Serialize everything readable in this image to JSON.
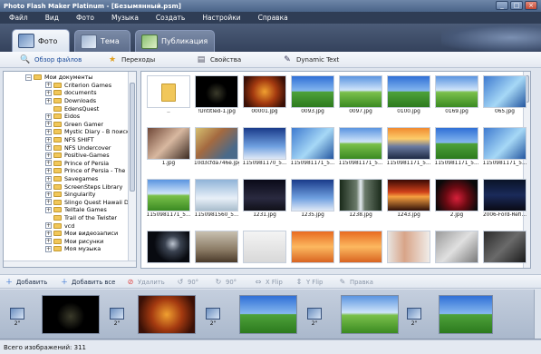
{
  "window": {
    "title": "Photo Flash Maker Platinum - [Безымянный.psm]"
  },
  "menu": [
    "Файл",
    "Вид",
    "Фото",
    "Музыка",
    "Создать",
    "Настройки",
    "Справка"
  ],
  "main_tabs": [
    {
      "label": "Фото",
      "active": true
    },
    {
      "label": "Тема",
      "active": false
    },
    {
      "label": "Публикация",
      "active": false
    }
  ],
  "sub_tabs": [
    {
      "label": "Обзор файлов",
      "icon": "magnifier-icon",
      "active": true
    },
    {
      "label": "Переходы",
      "icon": "star-icon",
      "active": false
    },
    {
      "label": "Свойства",
      "icon": "properties-icon",
      "active": false
    },
    {
      "label": "Dynamic Text",
      "icon": "text-icon",
      "active": false
    }
  ],
  "tree": [
    {
      "label": "Мои документы",
      "level": 0,
      "exp": "−"
    },
    {
      "label": "Criterion Games",
      "level": 1,
      "exp": "+"
    },
    {
      "label": "documents",
      "level": 1,
      "exp": "+"
    },
    {
      "label": "Downloads",
      "level": 1,
      "exp": "+"
    },
    {
      "label": "EdensQuest",
      "level": 1,
      "exp": ""
    },
    {
      "label": "Eidos",
      "level": 1,
      "exp": "+"
    },
    {
      "label": "Green Gamer",
      "level": 1,
      "exp": "+"
    },
    {
      "label": "Mystic Diary - В поисках",
      "level": 1,
      "exp": "+"
    },
    {
      "label": "NFS SHIFT",
      "level": 1,
      "exp": "+"
    },
    {
      "label": "NFS Undercover",
      "level": 1,
      "exp": "+"
    },
    {
      "label": "Positive-Games",
      "level": 1,
      "exp": "+"
    },
    {
      "label": "Prince of Persia",
      "level": 1,
      "exp": "+"
    },
    {
      "label": "Prince of Persia - The For",
      "level": 1,
      "exp": "+"
    },
    {
      "label": "Savegames",
      "level": 1,
      "exp": "+"
    },
    {
      "label": "ScreenSteps Library",
      "level": 1,
      "exp": "+"
    },
    {
      "label": "Singularity",
      "level": 1,
      "exp": "+"
    },
    {
      "label": "Slingo Quest Hawaii Docu",
      "level": 1,
      "exp": "+"
    },
    {
      "label": "Telltale Games",
      "level": 1,
      "exp": "+"
    },
    {
      "label": "Trail of the Twister",
      "level": 1,
      "exp": ""
    },
    {
      "label": "vcd",
      "level": 1,
      "exp": "+"
    },
    {
      "label": "Мои видеозаписи",
      "level": 1,
      "exp": "+"
    },
    {
      "label": "Мои рисунки",
      "level": 1,
      "exp": "+"
    },
    {
      "label": "Моя музыка",
      "level": 1,
      "exp": "+"
    }
  ],
  "thumbnails": [
    {
      "label": "..",
      "img": "i-folder"
    },
    {
      "label": "!Untitled-1.jpg",
      "img": "i-black"
    },
    {
      "label": "00001.jpg",
      "img": "i-fire"
    },
    {
      "label": "0093.jpg",
      "img": "i-field"
    },
    {
      "label": "0097.jpg",
      "img": "i-field2"
    },
    {
      "label": "0100.jpg",
      "img": "i-field"
    },
    {
      "label": "0169.jpg",
      "img": "i-field2"
    },
    {
      "label": "065.jpg",
      "img": "i-aqua"
    },
    {
      "label": "1.jpg",
      "img": "i-room"
    },
    {
      "label": "10d3cfda746e.jpg",
      "img": "i-collage"
    },
    {
      "label": "1150981170_5...",
      "img": "i-blue"
    },
    {
      "label": "1150981171_5...",
      "img": "i-aqua"
    },
    {
      "label": "1150981171_5...",
      "img": "i-field2"
    },
    {
      "label": "1150981171_5...",
      "img": "i-sunset"
    },
    {
      "label": "1150981171_5...",
      "img": "i-field"
    },
    {
      "label": "1150981171_5...",
      "img": "i-aqua"
    },
    {
      "label": "1150981171_5...",
      "img": "i-field2"
    },
    {
      "label": "1150981560_5...",
      "img": "i-snow"
    },
    {
      "label": "1231.jpg",
      "img": "i-dark"
    },
    {
      "label": "1235.jpg",
      "img": "i-blue"
    },
    {
      "label": "1238.jpg",
      "img": "i-waterfall"
    },
    {
      "label": "1243.jpg",
      "img": "i-redsun"
    },
    {
      "label": "2.jpg",
      "img": "i-berry"
    },
    {
      "label": "2006-Ford-Refl...",
      "img": "i-car"
    },
    {
      "label": "",
      "img": "i-moon"
    },
    {
      "label": "",
      "img": "i-sign"
    },
    {
      "label": "",
      "img": "i-white"
    },
    {
      "label": "",
      "img": "i-orange"
    },
    {
      "label": "",
      "img": "i-orange"
    },
    {
      "label": "",
      "img": "i-girl"
    },
    {
      "label": "",
      "img": "i-grey"
    },
    {
      "label": "",
      "img": "i-greydark"
    }
  ],
  "actions": [
    {
      "label": "Добавить",
      "icon": "add-icon",
      "enabled": true
    },
    {
      "label": "Добавить все",
      "icon": "add-all-icon",
      "enabled": true
    },
    {
      "label": "Удалить",
      "icon": "delete-icon",
      "enabled": false
    },
    {
      "label": "90°",
      "icon": "rotate-left-icon",
      "enabled": false
    },
    {
      "label": "90°",
      "icon": "rotate-right-icon",
      "enabled": false
    },
    {
      "label": "X Flip",
      "icon": "flip-x-icon",
      "enabled": false
    },
    {
      "label": "Y Flip",
      "icon": "flip-y-icon",
      "enabled": false
    },
    {
      "label": "Правка",
      "icon": "edit-icon",
      "enabled": false
    }
  ],
  "filmstrip": [
    {
      "kind": "transition",
      "label": "2\""
    },
    {
      "kind": "slide",
      "img": "i-black"
    },
    {
      "kind": "transition",
      "label": "2\""
    },
    {
      "kind": "slide",
      "img": "i-fire"
    },
    {
      "kind": "transition",
      "label": "2\""
    },
    {
      "kind": "slide",
      "img": "i-field"
    },
    {
      "kind": "transition",
      "label": "2\""
    },
    {
      "kind": "slide",
      "img": "i-field2"
    },
    {
      "kind": "transition",
      "label": "2\""
    },
    {
      "kind": "slide",
      "img": "i-field"
    }
  ],
  "status": {
    "text": "Всего изображений: 311"
  },
  "colors": {
    "menubar": "#2f3d55",
    "header": "#4c5c78",
    "accent": "#1a4a9a"
  }
}
